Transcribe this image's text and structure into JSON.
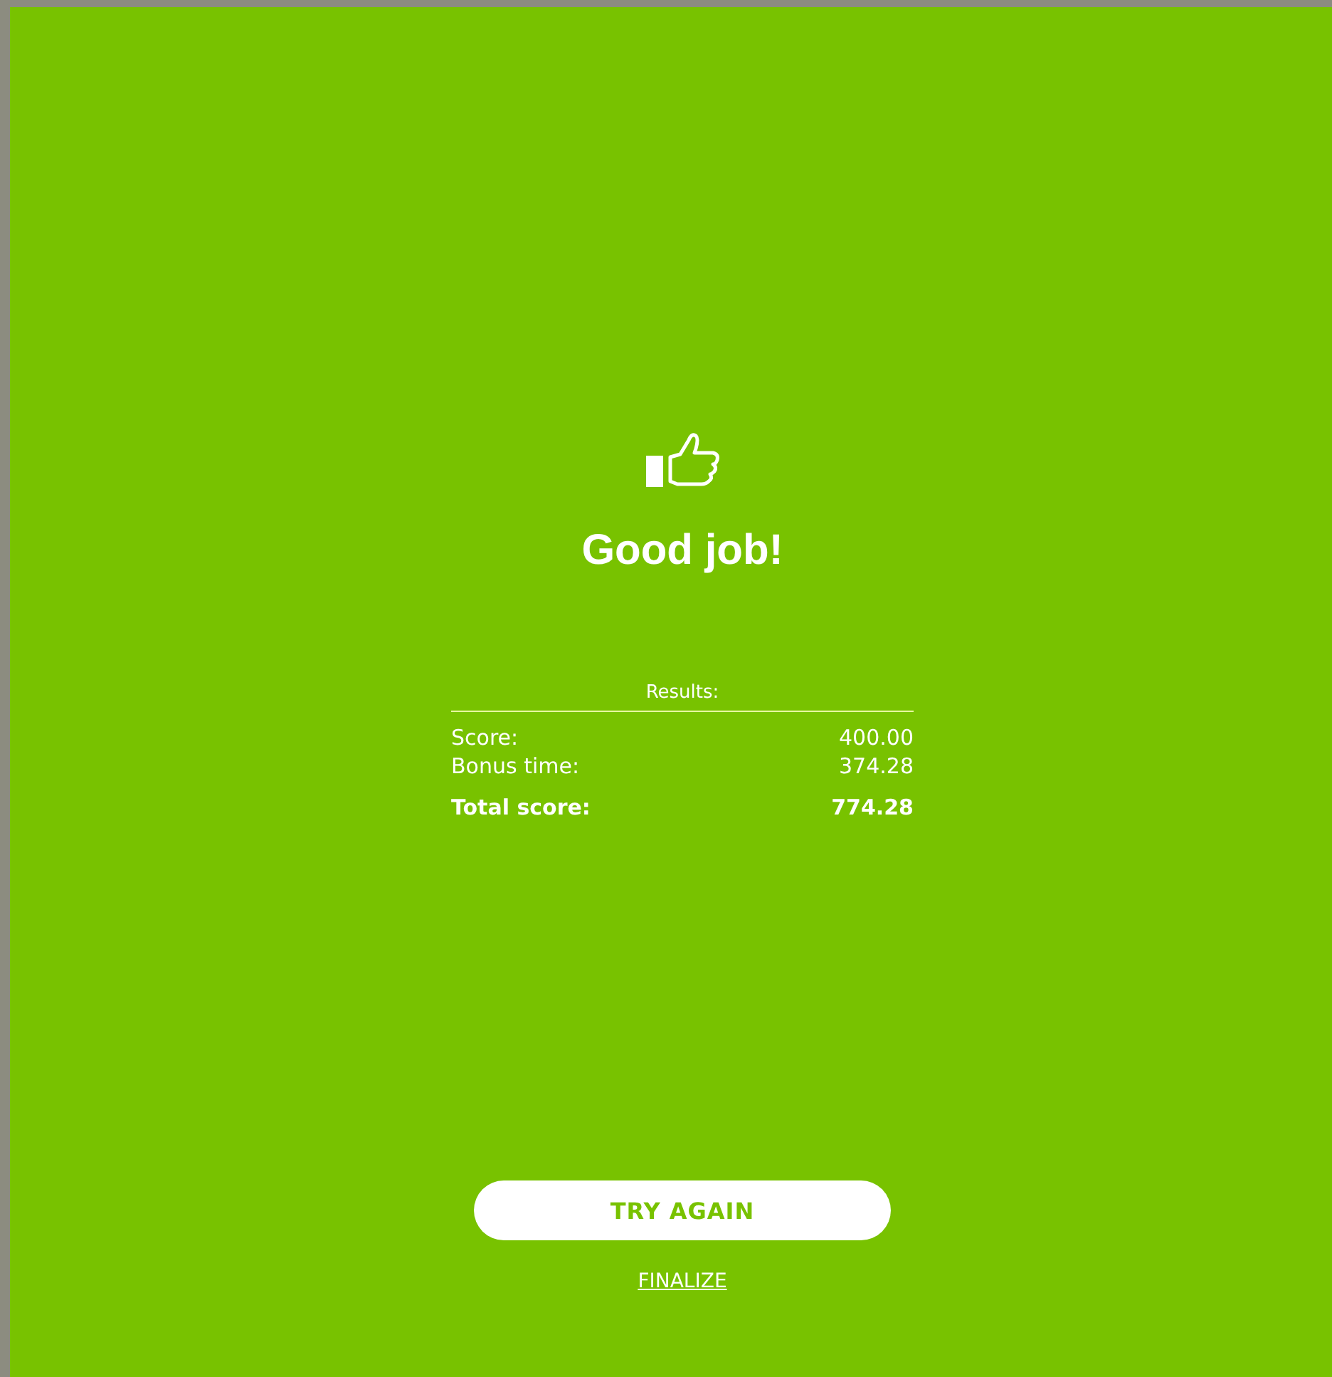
{
  "result": {
    "title": "Good job!"
  },
  "results": {
    "heading": "Results:",
    "rows": [
      {
        "kind": "regular",
        "label": "Score:",
        "value": "400.00"
      },
      {
        "kind": "regular",
        "label": "Bonus time:",
        "value": "374.28"
      },
      {
        "kind": "total",
        "label": "Total score:",
        "value": "774.28"
      }
    ]
  },
  "actions": {
    "primary": "TRY AGAIN",
    "link": "FINALIZE"
  }
}
